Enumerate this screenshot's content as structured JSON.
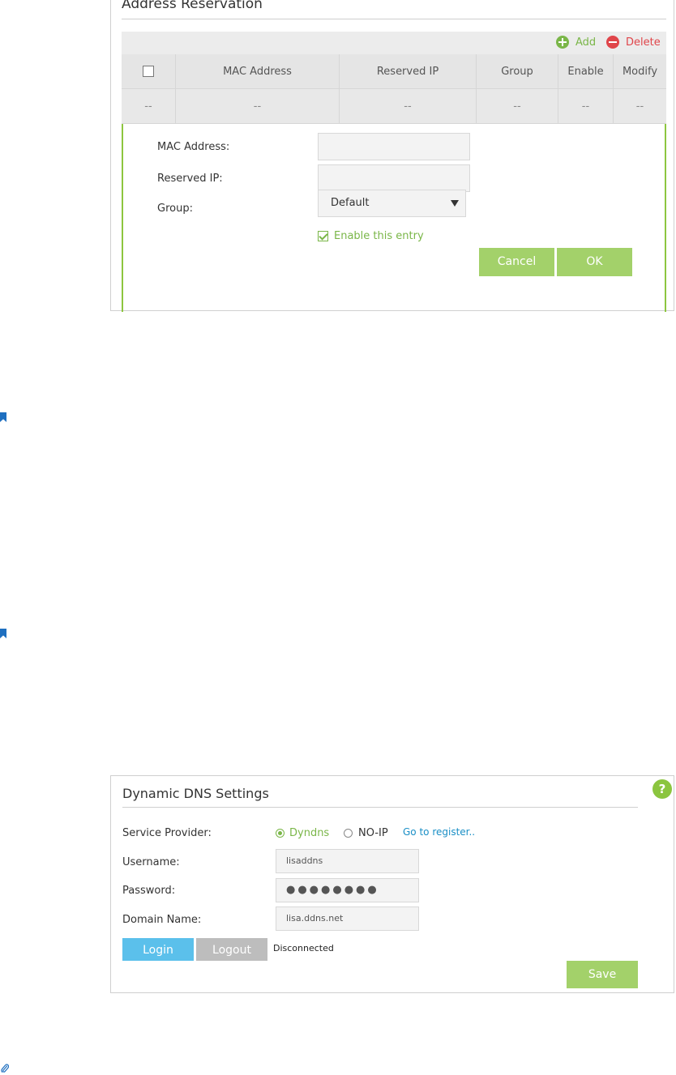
{
  "address_reservation": {
    "title": "Address Reservation",
    "toolbar": {
      "add_label": "Add",
      "delete_label": "Delete"
    },
    "table": {
      "headers": [
        "MAC Address",
        "Reserved IP",
        "Group",
        "Enable",
        "Modify"
      ],
      "row": [
        "--",
        "--",
        "--",
        "--",
        "--",
        "--"
      ]
    },
    "form": {
      "mac_label": "MAC Address:",
      "mac_value": "",
      "ip_label": "Reserved IP:",
      "ip_value": "",
      "group_label": "Group:",
      "group_value": "Default",
      "enable_label": "Enable this entry",
      "enable_checked": true,
      "cancel_label": "Cancel",
      "ok_label": "OK"
    }
  },
  "ddns": {
    "title": "Dynamic DNS Settings",
    "help_label": "?",
    "service_provider_label": "Service Provider:",
    "providers": [
      {
        "label": "Dyndns",
        "selected": true
      },
      {
        "label": "NO-IP",
        "selected": false
      }
    ],
    "register_link": "Go to register..",
    "username_label": "Username:",
    "username_value": "lisaddns",
    "password_label": "Password:",
    "password_mask": "●●●●●●●●",
    "domain_label": "Domain Name:",
    "domain_value": "lisa.ddns.net",
    "login_label": "Login",
    "logout_label": "Logout",
    "status": "Disconnected",
    "save_label": "Save"
  },
  "colors": {
    "accent_green": "#a3d16a",
    "add_green": "#7ab648",
    "delete_red": "#e0454a",
    "login_blue": "#5bc0eb",
    "link_blue": "#1a8fc6",
    "bookmark_blue": "#1e6fc0"
  },
  "icons": [
    "plus-circle-icon",
    "minus-circle-icon",
    "checkbox-icon",
    "caret-down-icon",
    "check-icon",
    "bookmark-icon",
    "help-icon",
    "paperclip-icon"
  ]
}
